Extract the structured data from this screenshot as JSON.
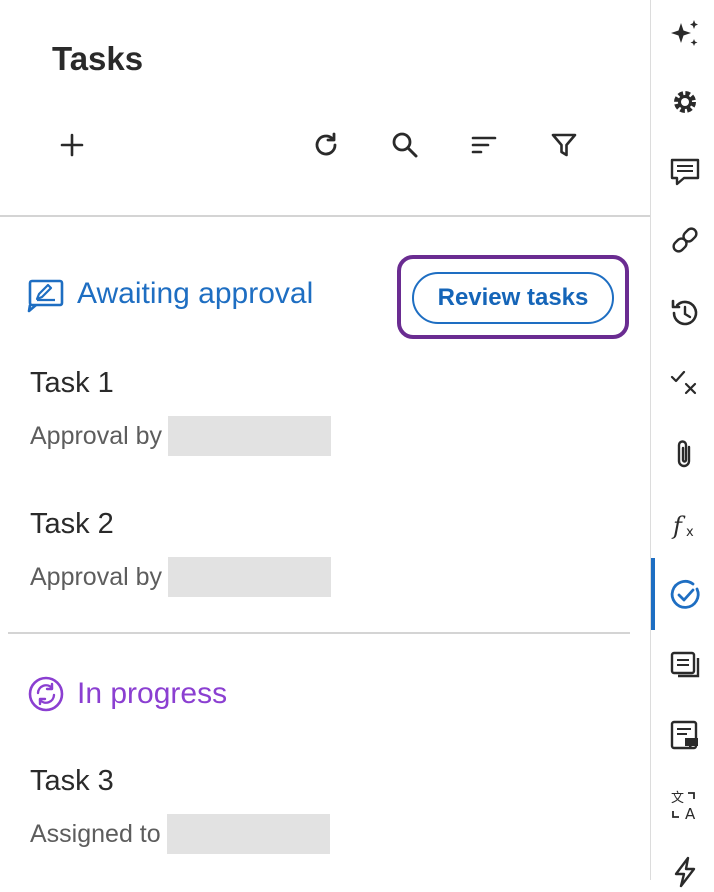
{
  "panel": {
    "title": "Tasks",
    "toolbar": {
      "add_icon": "plus-icon",
      "refresh_icon": "refresh-icon",
      "search_icon": "search-icon",
      "sort_icon": "sort-icon",
      "filter_icon": "filter-icon"
    }
  },
  "awaiting": {
    "label": "Awaiting approval",
    "icon": "signature-icon",
    "color": "#1e6ec2",
    "review_button_label": "Review tasks",
    "tasks": [
      {
        "name": "Task 1",
        "meta_label": "Approval by"
      },
      {
        "name": "Task 2",
        "meta_label": "Approval by"
      }
    ]
  },
  "in_progress": {
    "label": "In progress",
    "icon": "sync-icon",
    "color": "#8b3fd1",
    "tasks": [
      {
        "name": "Task 3",
        "meta_label": "Assigned to"
      }
    ]
  },
  "rail": {
    "items": [
      {
        "icon": "sparkle-icon"
      },
      {
        "icon": "gear-icon"
      },
      {
        "icon": "comment-icon"
      },
      {
        "icon": "link-icon"
      },
      {
        "icon": "history-icon"
      },
      {
        "icon": "check-x-icon"
      },
      {
        "icon": "paperclip-icon"
      },
      {
        "icon": "function-icon"
      },
      {
        "icon": "task-check-icon",
        "active": true
      },
      {
        "icon": "list-icon"
      },
      {
        "icon": "notes-icon"
      },
      {
        "icon": "translate-icon"
      },
      {
        "icon": "lightning-icon"
      }
    ],
    "accent_color": "#1e6ec2"
  }
}
